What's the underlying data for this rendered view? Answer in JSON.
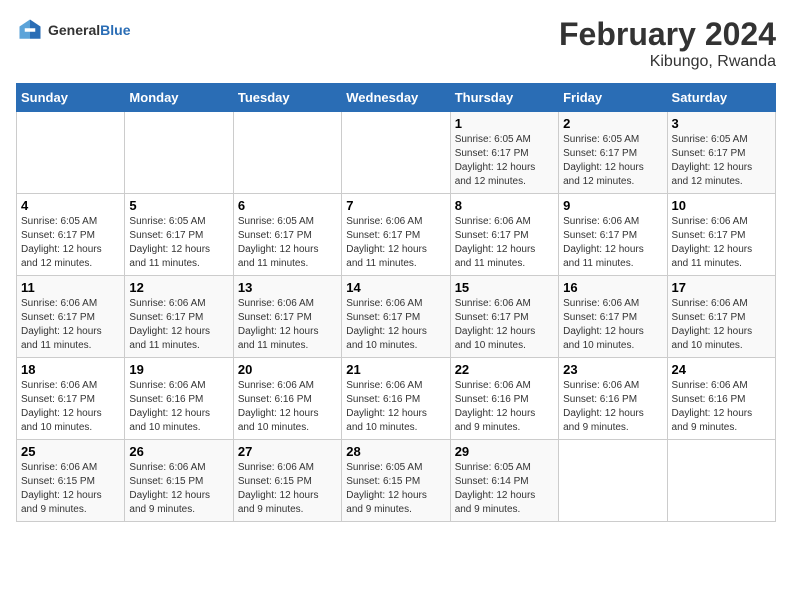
{
  "logo": {
    "general": "General",
    "blue": "Blue"
  },
  "title": "February 2024",
  "subtitle": "Kibungo, Rwanda",
  "days_of_week": [
    "Sunday",
    "Monday",
    "Tuesday",
    "Wednesday",
    "Thursday",
    "Friday",
    "Saturday"
  ],
  "weeks": [
    [
      {
        "day": "",
        "info": ""
      },
      {
        "day": "",
        "info": ""
      },
      {
        "day": "",
        "info": ""
      },
      {
        "day": "",
        "info": ""
      },
      {
        "day": "1",
        "info": "Sunrise: 6:05 AM\nSunset: 6:17 PM\nDaylight: 12 hours and 12 minutes."
      },
      {
        "day": "2",
        "info": "Sunrise: 6:05 AM\nSunset: 6:17 PM\nDaylight: 12 hours and 12 minutes."
      },
      {
        "day": "3",
        "info": "Sunrise: 6:05 AM\nSunset: 6:17 PM\nDaylight: 12 hours and 12 minutes."
      }
    ],
    [
      {
        "day": "4",
        "info": "Sunrise: 6:05 AM\nSunset: 6:17 PM\nDaylight: 12 hours and 12 minutes."
      },
      {
        "day": "5",
        "info": "Sunrise: 6:05 AM\nSunset: 6:17 PM\nDaylight: 12 hours and 11 minutes."
      },
      {
        "day": "6",
        "info": "Sunrise: 6:05 AM\nSunset: 6:17 PM\nDaylight: 12 hours and 11 minutes."
      },
      {
        "day": "7",
        "info": "Sunrise: 6:06 AM\nSunset: 6:17 PM\nDaylight: 12 hours and 11 minutes."
      },
      {
        "day": "8",
        "info": "Sunrise: 6:06 AM\nSunset: 6:17 PM\nDaylight: 12 hours and 11 minutes."
      },
      {
        "day": "9",
        "info": "Sunrise: 6:06 AM\nSunset: 6:17 PM\nDaylight: 12 hours and 11 minutes."
      },
      {
        "day": "10",
        "info": "Sunrise: 6:06 AM\nSunset: 6:17 PM\nDaylight: 12 hours and 11 minutes."
      }
    ],
    [
      {
        "day": "11",
        "info": "Sunrise: 6:06 AM\nSunset: 6:17 PM\nDaylight: 12 hours and 11 minutes."
      },
      {
        "day": "12",
        "info": "Sunrise: 6:06 AM\nSunset: 6:17 PM\nDaylight: 12 hours and 11 minutes."
      },
      {
        "day": "13",
        "info": "Sunrise: 6:06 AM\nSunset: 6:17 PM\nDaylight: 12 hours and 11 minutes."
      },
      {
        "day": "14",
        "info": "Sunrise: 6:06 AM\nSunset: 6:17 PM\nDaylight: 12 hours and 10 minutes."
      },
      {
        "day": "15",
        "info": "Sunrise: 6:06 AM\nSunset: 6:17 PM\nDaylight: 12 hours and 10 minutes."
      },
      {
        "day": "16",
        "info": "Sunrise: 6:06 AM\nSunset: 6:17 PM\nDaylight: 12 hours and 10 minutes."
      },
      {
        "day": "17",
        "info": "Sunrise: 6:06 AM\nSunset: 6:17 PM\nDaylight: 12 hours and 10 minutes."
      }
    ],
    [
      {
        "day": "18",
        "info": "Sunrise: 6:06 AM\nSunset: 6:17 PM\nDaylight: 12 hours and 10 minutes."
      },
      {
        "day": "19",
        "info": "Sunrise: 6:06 AM\nSunset: 6:16 PM\nDaylight: 12 hours and 10 minutes."
      },
      {
        "day": "20",
        "info": "Sunrise: 6:06 AM\nSunset: 6:16 PM\nDaylight: 12 hours and 10 minutes."
      },
      {
        "day": "21",
        "info": "Sunrise: 6:06 AM\nSunset: 6:16 PM\nDaylight: 12 hours and 10 minutes."
      },
      {
        "day": "22",
        "info": "Sunrise: 6:06 AM\nSunset: 6:16 PM\nDaylight: 12 hours and 9 minutes."
      },
      {
        "day": "23",
        "info": "Sunrise: 6:06 AM\nSunset: 6:16 PM\nDaylight: 12 hours and 9 minutes."
      },
      {
        "day": "24",
        "info": "Sunrise: 6:06 AM\nSunset: 6:16 PM\nDaylight: 12 hours and 9 minutes."
      }
    ],
    [
      {
        "day": "25",
        "info": "Sunrise: 6:06 AM\nSunset: 6:15 PM\nDaylight: 12 hours and 9 minutes."
      },
      {
        "day": "26",
        "info": "Sunrise: 6:06 AM\nSunset: 6:15 PM\nDaylight: 12 hours and 9 minutes."
      },
      {
        "day": "27",
        "info": "Sunrise: 6:06 AM\nSunset: 6:15 PM\nDaylight: 12 hours and 9 minutes."
      },
      {
        "day": "28",
        "info": "Sunrise: 6:05 AM\nSunset: 6:15 PM\nDaylight: 12 hours and 9 minutes."
      },
      {
        "day": "29",
        "info": "Sunrise: 6:05 AM\nSunset: 6:14 PM\nDaylight: 12 hours and 9 minutes."
      },
      {
        "day": "",
        "info": ""
      },
      {
        "day": "",
        "info": ""
      }
    ]
  ]
}
